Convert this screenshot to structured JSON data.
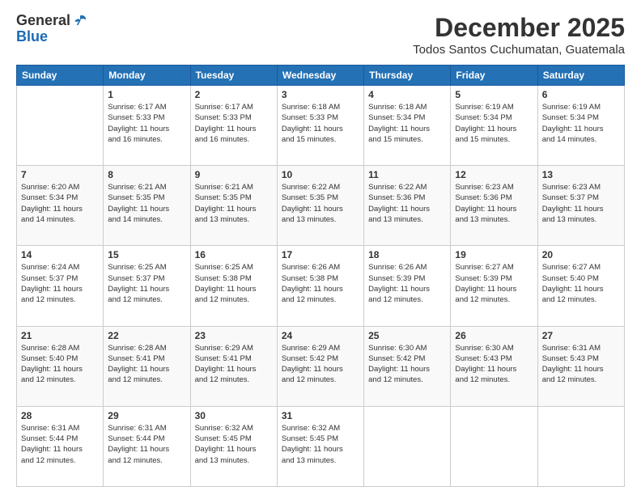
{
  "header": {
    "logo_general": "General",
    "logo_blue": "Blue",
    "month_title": "December 2025",
    "location": "Todos Santos Cuchumatan, Guatemala"
  },
  "calendar": {
    "days_of_week": [
      "Sunday",
      "Monday",
      "Tuesday",
      "Wednesday",
      "Thursday",
      "Friday",
      "Saturday"
    ],
    "weeks": [
      [
        {
          "day": "",
          "info": ""
        },
        {
          "day": "1",
          "info": "Sunrise: 6:17 AM\nSunset: 5:33 PM\nDaylight: 11 hours\nand 16 minutes."
        },
        {
          "day": "2",
          "info": "Sunrise: 6:17 AM\nSunset: 5:33 PM\nDaylight: 11 hours\nand 16 minutes."
        },
        {
          "day": "3",
          "info": "Sunrise: 6:18 AM\nSunset: 5:33 PM\nDaylight: 11 hours\nand 15 minutes."
        },
        {
          "day": "4",
          "info": "Sunrise: 6:18 AM\nSunset: 5:34 PM\nDaylight: 11 hours\nand 15 minutes."
        },
        {
          "day": "5",
          "info": "Sunrise: 6:19 AM\nSunset: 5:34 PM\nDaylight: 11 hours\nand 15 minutes."
        },
        {
          "day": "6",
          "info": "Sunrise: 6:19 AM\nSunset: 5:34 PM\nDaylight: 11 hours\nand 14 minutes."
        }
      ],
      [
        {
          "day": "7",
          "info": "Sunrise: 6:20 AM\nSunset: 5:34 PM\nDaylight: 11 hours\nand 14 minutes."
        },
        {
          "day": "8",
          "info": "Sunrise: 6:21 AM\nSunset: 5:35 PM\nDaylight: 11 hours\nand 14 minutes."
        },
        {
          "day": "9",
          "info": "Sunrise: 6:21 AM\nSunset: 5:35 PM\nDaylight: 11 hours\nand 13 minutes."
        },
        {
          "day": "10",
          "info": "Sunrise: 6:22 AM\nSunset: 5:35 PM\nDaylight: 11 hours\nand 13 minutes."
        },
        {
          "day": "11",
          "info": "Sunrise: 6:22 AM\nSunset: 5:36 PM\nDaylight: 11 hours\nand 13 minutes."
        },
        {
          "day": "12",
          "info": "Sunrise: 6:23 AM\nSunset: 5:36 PM\nDaylight: 11 hours\nand 13 minutes."
        },
        {
          "day": "13",
          "info": "Sunrise: 6:23 AM\nSunset: 5:37 PM\nDaylight: 11 hours\nand 13 minutes."
        }
      ],
      [
        {
          "day": "14",
          "info": "Sunrise: 6:24 AM\nSunset: 5:37 PM\nDaylight: 11 hours\nand 12 minutes."
        },
        {
          "day": "15",
          "info": "Sunrise: 6:25 AM\nSunset: 5:37 PM\nDaylight: 11 hours\nand 12 minutes."
        },
        {
          "day": "16",
          "info": "Sunrise: 6:25 AM\nSunset: 5:38 PM\nDaylight: 11 hours\nand 12 minutes."
        },
        {
          "day": "17",
          "info": "Sunrise: 6:26 AM\nSunset: 5:38 PM\nDaylight: 11 hours\nand 12 minutes."
        },
        {
          "day": "18",
          "info": "Sunrise: 6:26 AM\nSunset: 5:39 PM\nDaylight: 11 hours\nand 12 minutes."
        },
        {
          "day": "19",
          "info": "Sunrise: 6:27 AM\nSunset: 5:39 PM\nDaylight: 11 hours\nand 12 minutes."
        },
        {
          "day": "20",
          "info": "Sunrise: 6:27 AM\nSunset: 5:40 PM\nDaylight: 11 hours\nand 12 minutes."
        }
      ],
      [
        {
          "day": "21",
          "info": "Sunrise: 6:28 AM\nSunset: 5:40 PM\nDaylight: 11 hours\nand 12 minutes."
        },
        {
          "day": "22",
          "info": "Sunrise: 6:28 AM\nSunset: 5:41 PM\nDaylight: 11 hours\nand 12 minutes."
        },
        {
          "day": "23",
          "info": "Sunrise: 6:29 AM\nSunset: 5:41 PM\nDaylight: 11 hours\nand 12 minutes."
        },
        {
          "day": "24",
          "info": "Sunrise: 6:29 AM\nSunset: 5:42 PM\nDaylight: 11 hours\nand 12 minutes."
        },
        {
          "day": "25",
          "info": "Sunrise: 6:30 AM\nSunset: 5:42 PM\nDaylight: 11 hours\nand 12 minutes."
        },
        {
          "day": "26",
          "info": "Sunrise: 6:30 AM\nSunset: 5:43 PM\nDaylight: 11 hours\nand 12 minutes."
        },
        {
          "day": "27",
          "info": "Sunrise: 6:31 AM\nSunset: 5:43 PM\nDaylight: 11 hours\nand 12 minutes."
        }
      ],
      [
        {
          "day": "28",
          "info": "Sunrise: 6:31 AM\nSunset: 5:44 PM\nDaylight: 11 hours\nand 12 minutes."
        },
        {
          "day": "29",
          "info": "Sunrise: 6:31 AM\nSunset: 5:44 PM\nDaylight: 11 hours\nand 12 minutes."
        },
        {
          "day": "30",
          "info": "Sunrise: 6:32 AM\nSunset: 5:45 PM\nDaylight: 11 hours\nand 13 minutes."
        },
        {
          "day": "31",
          "info": "Sunrise: 6:32 AM\nSunset: 5:45 PM\nDaylight: 11 hours\nand 13 minutes."
        },
        {
          "day": "",
          "info": ""
        },
        {
          "day": "",
          "info": ""
        },
        {
          "day": "",
          "info": ""
        }
      ]
    ]
  }
}
